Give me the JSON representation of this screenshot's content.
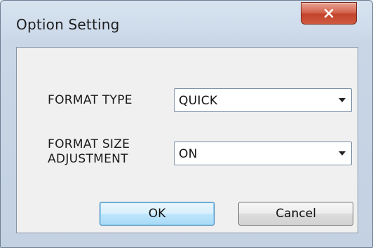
{
  "dialog": {
    "title": "Option Setting",
    "close_icon": "close-x-icon"
  },
  "fields": {
    "format_type": {
      "label": "FORMAT TYPE",
      "value": "QUICK"
    },
    "format_size_adjustment": {
      "label_line1": "FORMAT SIZE",
      "label_line2": "ADJUSTMENT",
      "value": "ON"
    }
  },
  "buttons": {
    "ok_label": "OK",
    "cancel_label": "Cancel"
  },
  "colors": {
    "close_button": "#c7452d",
    "default_button_border": "#3c7fb1"
  }
}
